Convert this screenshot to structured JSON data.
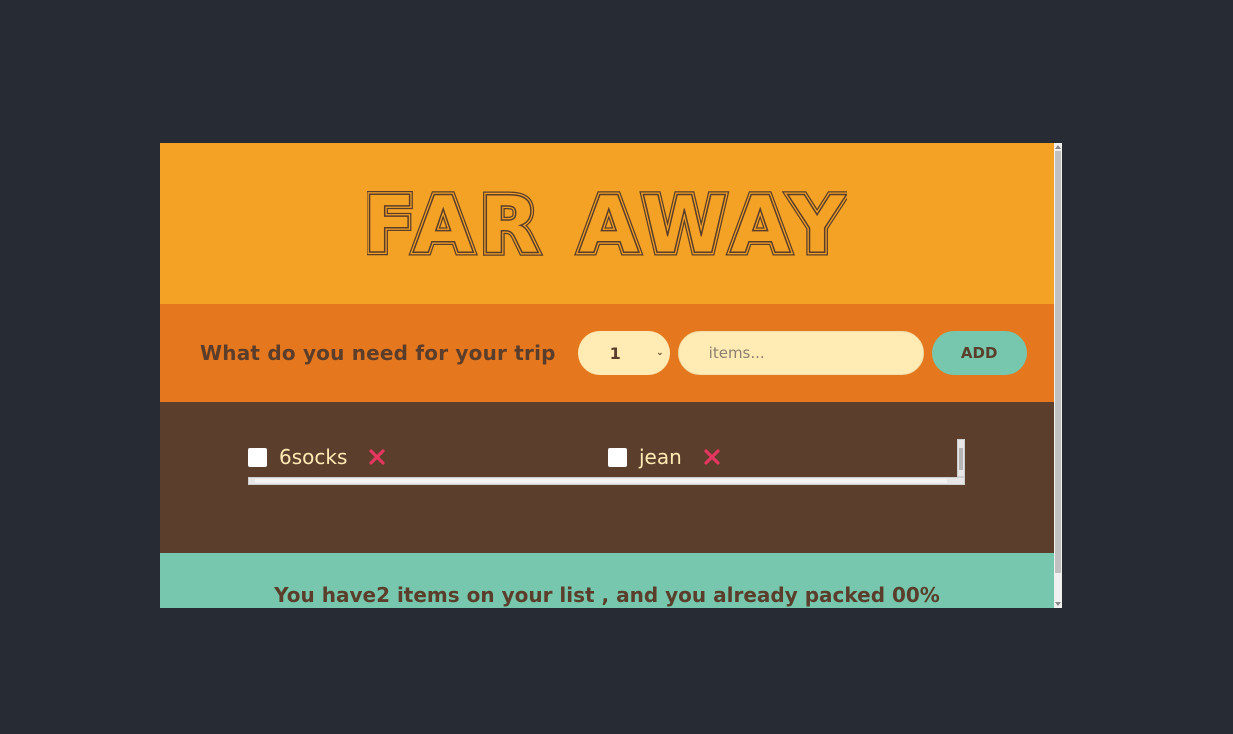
{
  "app": {
    "title": "FAR AWAY"
  },
  "form": {
    "label": "What do you need for your trip",
    "quantity_value": "1",
    "item_placeholder": "items...",
    "add_label": "ADD"
  },
  "list": {
    "items": [
      {
        "text": "6socks",
        "packed": false,
        "delete_icon": "close-icon"
      },
      {
        "text": "jean",
        "packed": false,
        "delete_icon": "close-icon"
      }
    ]
  },
  "stats": {
    "text": "You have2 items on your list , and you already packed 00%"
  },
  "colors": {
    "background": "#272b33",
    "header": "#f4a226",
    "form": "#e5771f",
    "list": "#5b3e2c",
    "stats": "#76c7ad",
    "text_dark": "#5a3e2b",
    "text_light": "#ffebb3",
    "delete": "#e5365f"
  }
}
